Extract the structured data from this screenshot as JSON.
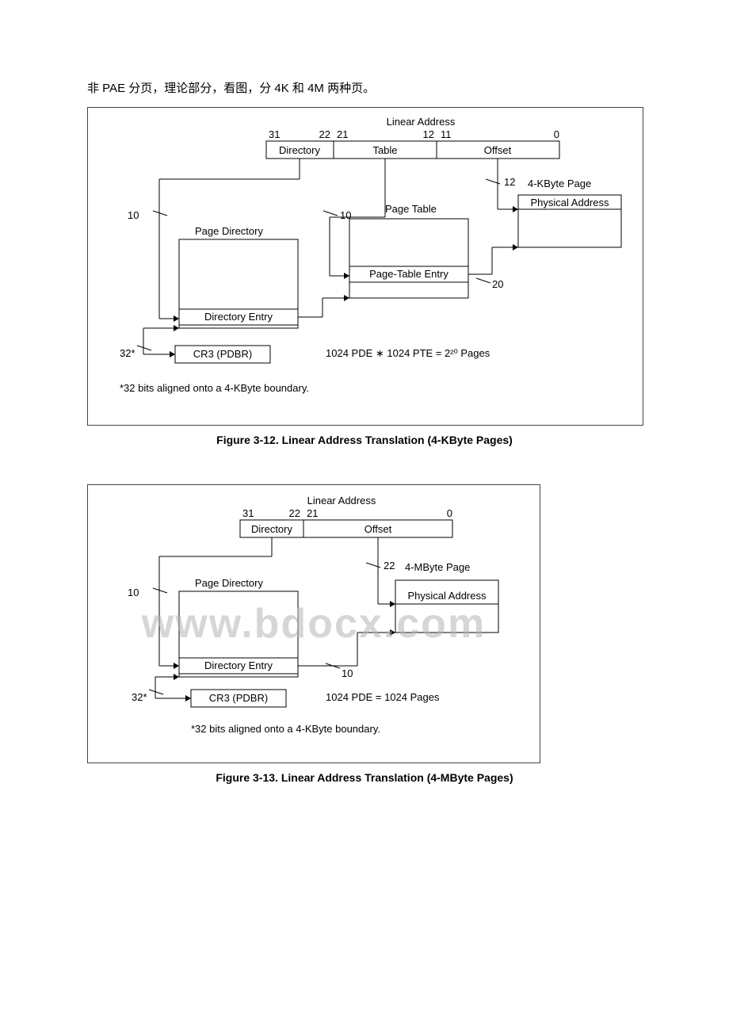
{
  "intro": "非 PAE 分页，理论部分，看图，分 4K 和 4M 两种页。",
  "watermark": "www.bdocx.com",
  "fig1": {
    "linear_address_label": "Linear Address",
    "bits": [
      "31",
      "22",
      "21",
      "12",
      "11",
      "0"
    ],
    "fields": [
      "Directory",
      "Table",
      "Offset"
    ],
    "page_label": "4-KByte Page",
    "phys_addr": "Physical Address",
    "page_table": "Page Table",
    "pte": "Page-Table Entry",
    "page_dir": "Page Directory",
    "dir_entry": "Directory Entry",
    "cr3": "CR3 (PDBR)",
    "tick10a": "10",
    "tick10b": "10",
    "tick12": "12",
    "tick20": "20",
    "tick32": "32*",
    "math": "1024 PDE ∗ 1024 PTE = 2²⁰ Pages",
    "footnote": "*32 bits aligned onto a 4-KByte boundary.",
    "caption": "Figure 3-12.  Linear Address Translation (4-KByte Pages)"
  },
  "fig2": {
    "linear_address_label": "Linear Address",
    "bits": [
      "31",
      "22",
      "21",
      "0"
    ],
    "fields": [
      "Directory",
      "Offset"
    ],
    "page_label": "4-MByte Page",
    "phys_addr": "Physical Address",
    "page_dir": "Page Directory",
    "dir_entry": "Directory Entry",
    "cr3": "CR3 (PDBR)",
    "tick10a": "10",
    "tick22": "22",
    "tick10b": "10",
    "tick32": "32*",
    "math": "1024 PDE = 1024 Pages",
    "footnote": "*32 bits aligned onto a 4-KByte boundary.",
    "caption": "Figure 3-13.  Linear Address Translation (4-MByte Pages)"
  }
}
